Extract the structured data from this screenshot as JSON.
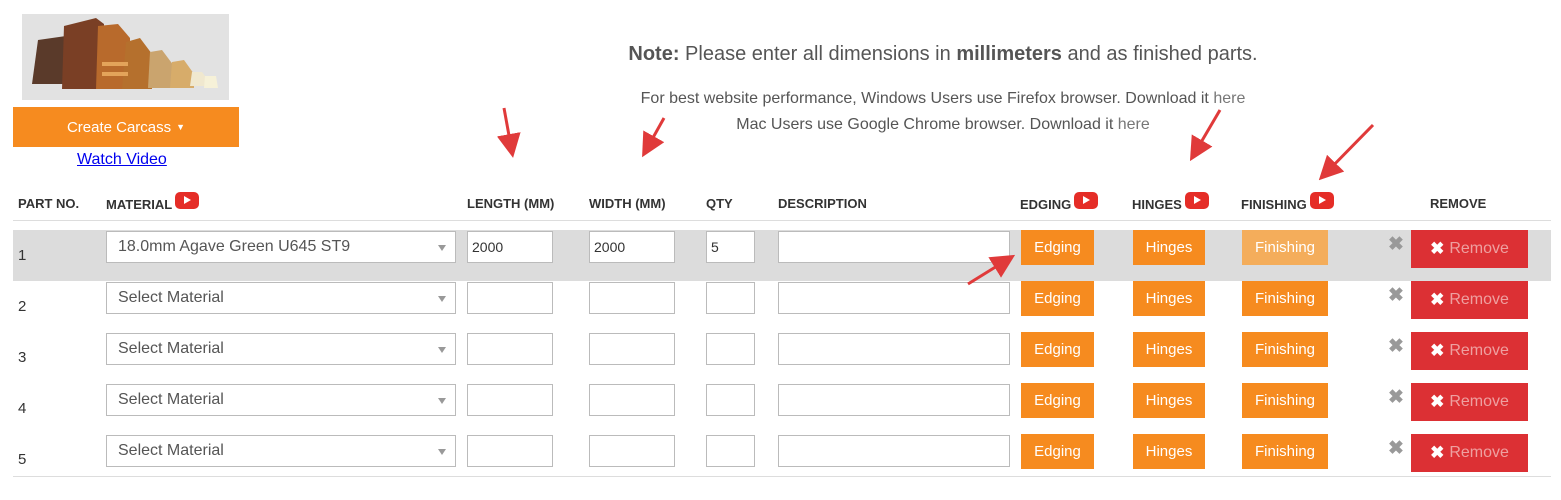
{
  "sidebar": {
    "create_label": "Create Carcass",
    "watch_video": "Watch Video"
  },
  "note": {
    "label": "Note:",
    "text1": " Please enter all dimensions in ",
    "bold": "millimeters",
    "text2": " and as finished parts."
  },
  "performance": {
    "windows_text": "For best website performance, Windows Users use Firefox browser. Download it ",
    "windows_link": "here",
    "mac_text": "Mac Users use Google Chrome browser. Download it ",
    "mac_link": "here"
  },
  "columns": {
    "part_no": "PART NO.",
    "material": "MATERIAL",
    "length": "LENGTH (MM)",
    "width": "WIDTH (MM)",
    "qty": "QTY",
    "description": "DESCRIPTION",
    "edging": "EDGING",
    "hinges": "HINGES",
    "finishing": "FINISHING",
    "remove": "REMOVE"
  },
  "rows": [
    {
      "part_no": "1",
      "material": "18.0mm Agave Green U645 ST9",
      "length": "2000",
      "width": "2000",
      "qty": "5",
      "description": ""
    },
    {
      "part_no": "2",
      "material": "Select Material",
      "length": "",
      "width": "",
      "qty": "",
      "description": ""
    },
    {
      "part_no": "3",
      "material": "Select Material",
      "length": "",
      "width": "",
      "qty": "",
      "description": ""
    },
    {
      "part_no": "4",
      "material": "Select Material",
      "length": "",
      "width": "",
      "qty": "",
      "description": ""
    },
    {
      "part_no": "5",
      "material": "Select Material",
      "length": "",
      "width": "",
      "qty": "",
      "description": ""
    }
  ],
  "buttons": {
    "edging": "Edging",
    "hinges": "Hinges",
    "finishing": "Finishing",
    "remove": "Remove"
  },
  "colors": {
    "orange": "#f68b1f",
    "light_orange": "#f4ad5b",
    "red": "#dc3034",
    "youtube": "#e52d27",
    "arrow": "#e03a3a"
  },
  "icons": [
    "youtube-icon",
    "close-icon",
    "caret-down-icon"
  ]
}
